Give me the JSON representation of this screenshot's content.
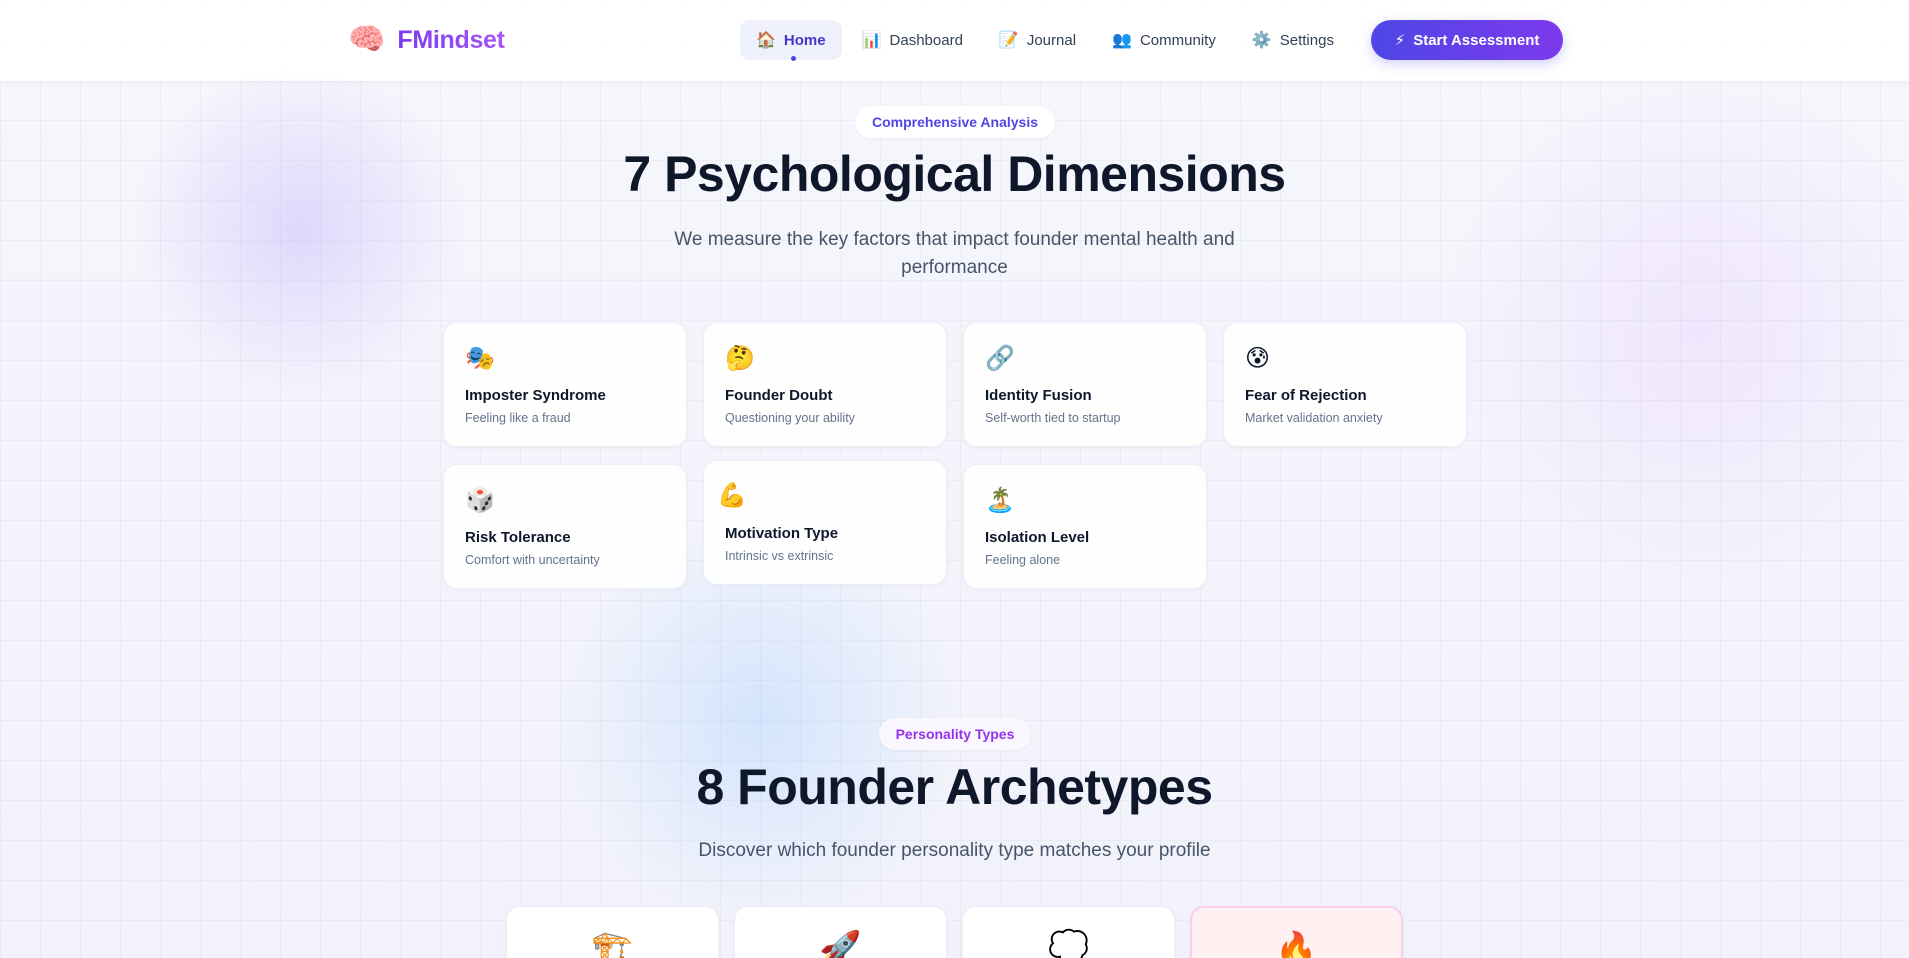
{
  "app": {
    "logo_icon": "🧠",
    "name": "FMindset"
  },
  "nav": [
    {
      "icon": "🏠",
      "label": "Home",
      "active": true
    },
    {
      "icon": "📊",
      "label": "Dashboard"
    },
    {
      "icon": "📝",
      "label": "Journal"
    },
    {
      "icon": "👥",
      "label": "Community"
    },
    {
      "icon": "⚙️",
      "label": "Settings"
    }
  ],
  "cta": {
    "icon": "⚡",
    "label": "Start Assessment"
  },
  "dimensions": {
    "badge": "Comprehensive Analysis",
    "title": "7 Psychological Dimensions",
    "subtitle": "We measure the key factors that impact founder mental health and performance",
    "cards": [
      {
        "icon": "🎭",
        "title": "Imposter Syndrome",
        "desc": "Feeling like a fraud"
      },
      {
        "icon": "🤔",
        "title": "Founder Doubt",
        "desc": "Questioning your ability"
      },
      {
        "icon": "🔗",
        "title": "Identity Fusion",
        "desc": "Self-worth tied to startup"
      },
      {
        "icon": "😰",
        "title": "Fear of Rejection",
        "desc": "Market validation anxiety"
      },
      {
        "icon": "🎲",
        "title": "Risk Tolerance",
        "desc": "Comfort with uncertainty"
      },
      {
        "icon": "💪",
        "title": "Motivation Type",
        "desc": "Intrinsic vs extrinsic"
      },
      {
        "icon": "🏝️",
        "title": "Isolation Level",
        "desc": "Feeling alone"
      }
    ]
  },
  "archetypes": {
    "badge": "Personality Types",
    "title": "8 Founder Archetypes",
    "subtitle": "Discover which founder personality type matches your profile",
    "cards": [
      {
        "icon": "🏗️"
      },
      {
        "icon": "🚀"
      },
      {
        "icon": "💭"
      },
      {
        "icon": "🔥"
      }
    ]
  },
  "colors": {
    "accent": "#4f46e5",
    "brand": "#7c3aed",
    "archetype_highlight": "#fff1f2"
  }
}
